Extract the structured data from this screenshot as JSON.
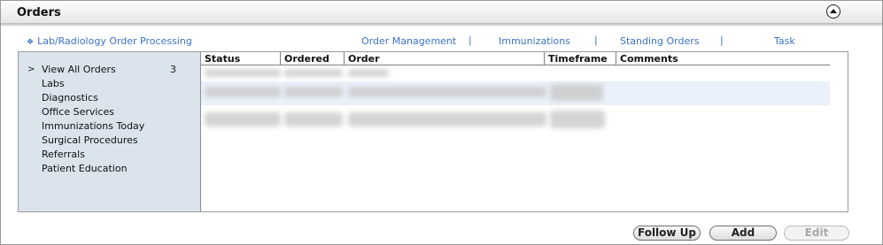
{
  "header": {
    "title": "Orders",
    "collapse_icon": "chevron-up-icon"
  },
  "links": {
    "lab_processing": "Lab/Radiology Order Processing",
    "order_management": "Order Management",
    "immunizations": "Immunizations",
    "standing_orders": "Standing Orders",
    "task": "Task",
    "separator": "|"
  },
  "sidebar": {
    "items": [
      {
        "label": "View All Orders",
        "count": "3",
        "selected": true
      },
      {
        "label": "Labs"
      },
      {
        "label": "Diagnostics"
      },
      {
        "label": "Office Services"
      },
      {
        "label": "Immunizations Today"
      },
      {
        "label": "Surgical Procedures"
      },
      {
        "label": "Referrals"
      },
      {
        "label": "Patient Education"
      }
    ],
    "selected_marker": ">"
  },
  "grid": {
    "columns": [
      "Status",
      "Ordered",
      "Order",
      "Timeframe",
      "Comments"
    ]
  },
  "buttons": {
    "follow_up": "Follow Up",
    "add": "Add",
    "edit": "Edit"
  },
  "colors": {
    "accent_link": "#3b73c6",
    "sidebar_bg": "#dbe3ed",
    "row_highlight": "#eaf1fb"
  }
}
